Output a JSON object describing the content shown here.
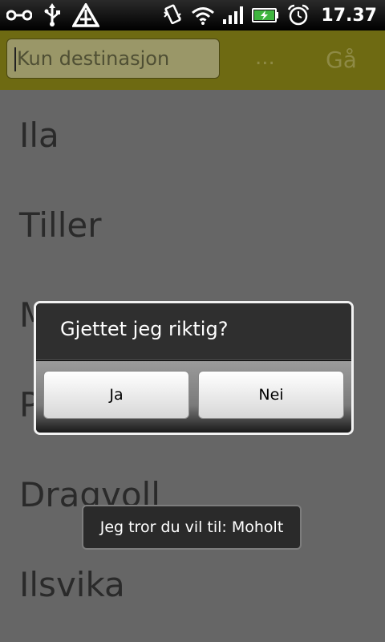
{
  "status_bar": {
    "time": "17.37",
    "icons": [
      "link-icon",
      "usb-icon",
      "warning-icon",
      "vibrate-icon",
      "wifi-icon",
      "signal-icon",
      "battery-charging-icon",
      "alarm-icon"
    ]
  },
  "toolbar": {
    "search_placeholder": "Kun destinasjon",
    "more_label": "...",
    "go_label": "Gå"
  },
  "list": {
    "items": [
      "Ila",
      "Tiller",
      "M",
      "P",
      "Dragvoll",
      "Ilsvika"
    ]
  },
  "dialog": {
    "title": "Gjettet jeg riktig?",
    "yes_label": "Ja",
    "no_label": "Nei"
  },
  "toast": {
    "message": "Jeg tror du vil til: Moholt"
  },
  "colors": {
    "toolbar": "#6e6a12",
    "list_background": "#666666",
    "dialog_background": "#000000"
  }
}
